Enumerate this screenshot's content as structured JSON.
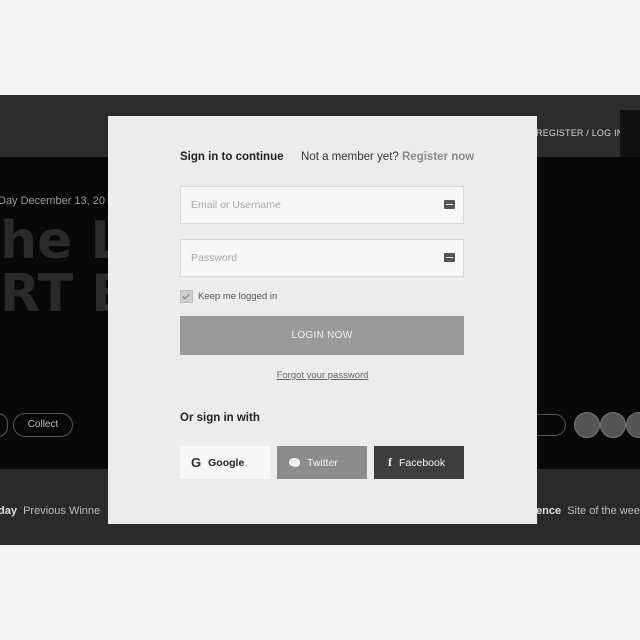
{
  "background": {
    "register_login": "REGISTER / LOG IN",
    "date": "Day  December 13, 20",
    "hero_line1": "he L",
    "hero_line2": "RT B",
    "collect_label": "Collect",
    "footer_left_bold": "day",
    "footer_left_text": "Previous Winne",
    "footer_right_bold": "ence",
    "footer_right_text": "Site of the wee"
  },
  "modal": {
    "title": "Sign in to continue",
    "member_text": "Not a member yet?",
    "register_link": "Register now",
    "email_placeholder": "Email or Username",
    "password_placeholder": "Password",
    "remember_label": "Keep me logged in",
    "remember_checked": true,
    "login_button": "LOGIN NOW",
    "forgot_link": "Forgot your password",
    "or_sign_in": "Or sign in with",
    "social": {
      "google": "Google",
      "twitter": "Twitter",
      "facebook": "Facebook"
    }
  },
  "icons": {
    "email_field": "key-icon",
    "password_field": "key-icon",
    "google": "google-icon",
    "twitter": "twitter-icon",
    "facebook": "facebook-icon"
  },
  "colors": {
    "modal_bg": "#ececec",
    "login_button": "#9a9a9a",
    "twitter_button": "#8c8c8c",
    "facebook_button": "#3e3e3e"
  }
}
